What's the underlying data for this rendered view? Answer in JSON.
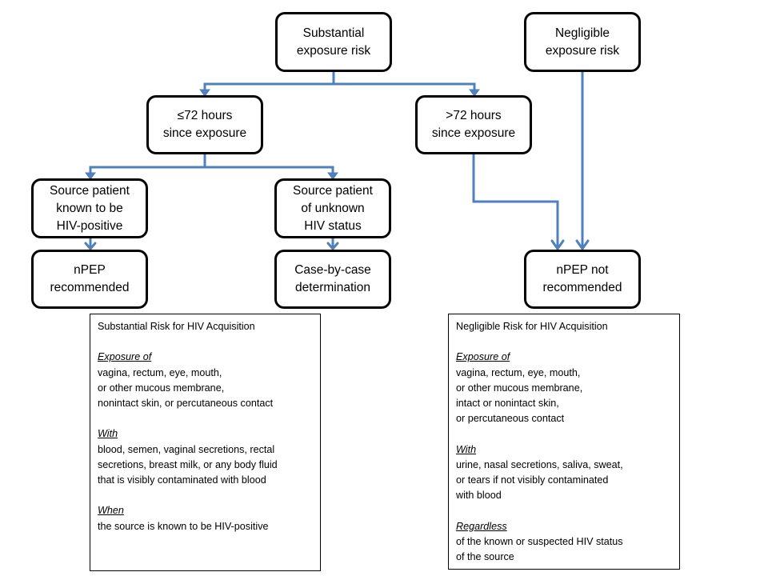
{
  "colors": {
    "connector": "#4f81bd",
    "box_border": "#000000",
    "background": "#ffffff"
  },
  "nodes": {
    "substantial_risk": [
      "Substantial",
      "exposure risk"
    ],
    "negligible_risk": [
      "Negligible",
      "exposure risk"
    ],
    "within_72h": [
      "≤72 hours",
      "since exposure"
    ],
    "over_72h": [
      ">72 hours",
      "since exposure"
    ],
    "source_known_positive": [
      "Source patient",
      "known to be",
      "HIV-positive"
    ],
    "source_unknown_status": [
      "Source patient",
      "of unknown",
      "HIV status"
    ],
    "npep_recommended": [
      "nPEP",
      "recommended"
    ],
    "case_by_case": [
      "Case-by-case",
      "determination"
    ],
    "npep_not_recommended": [
      "nPEP not",
      "recommended"
    ]
  },
  "substantial_panel": {
    "title": "Substantial Risk for HIV Acquisition",
    "sections": [
      {
        "heading": "Exposure of",
        "lines": [
          "vagina, rectum, eye, mouth,",
          "or other mucous membrane,",
          "nonintact skin, or percutaneous contact"
        ]
      },
      {
        "heading": "With",
        "lines": [
          "blood, semen, vaginal secretions, rectal",
          "secretions, breast milk, or any body fluid",
          "that is visibly contaminated with blood"
        ]
      },
      {
        "heading": "When",
        "lines": [
          "the source is known to be HIV-positive"
        ]
      }
    ]
  },
  "negligible_panel": {
    "title": "Negligible Risk for HIV Acquisition",
    "sections": [
      {
        "heading": "Exposure of",
        "lines": [
          "vagina, rectum, eye, mouth,",
          "or other mucous membrane,",
          "intact or nonintact skin,",
          "or percutaneous contact"
        ]
      },
      {
        "heading": "With",
        "lines": [
          "urine, nasal secretions, saliva, sweat,",
          "or tears if not visibly contaminated",
          "with blood"
        ]
      },
      {
        "heading": "Regardless",
        "lines": [
          "of the known or suspected HIV status",
          "of the source"
        ]
      }
    ]
  }
}
